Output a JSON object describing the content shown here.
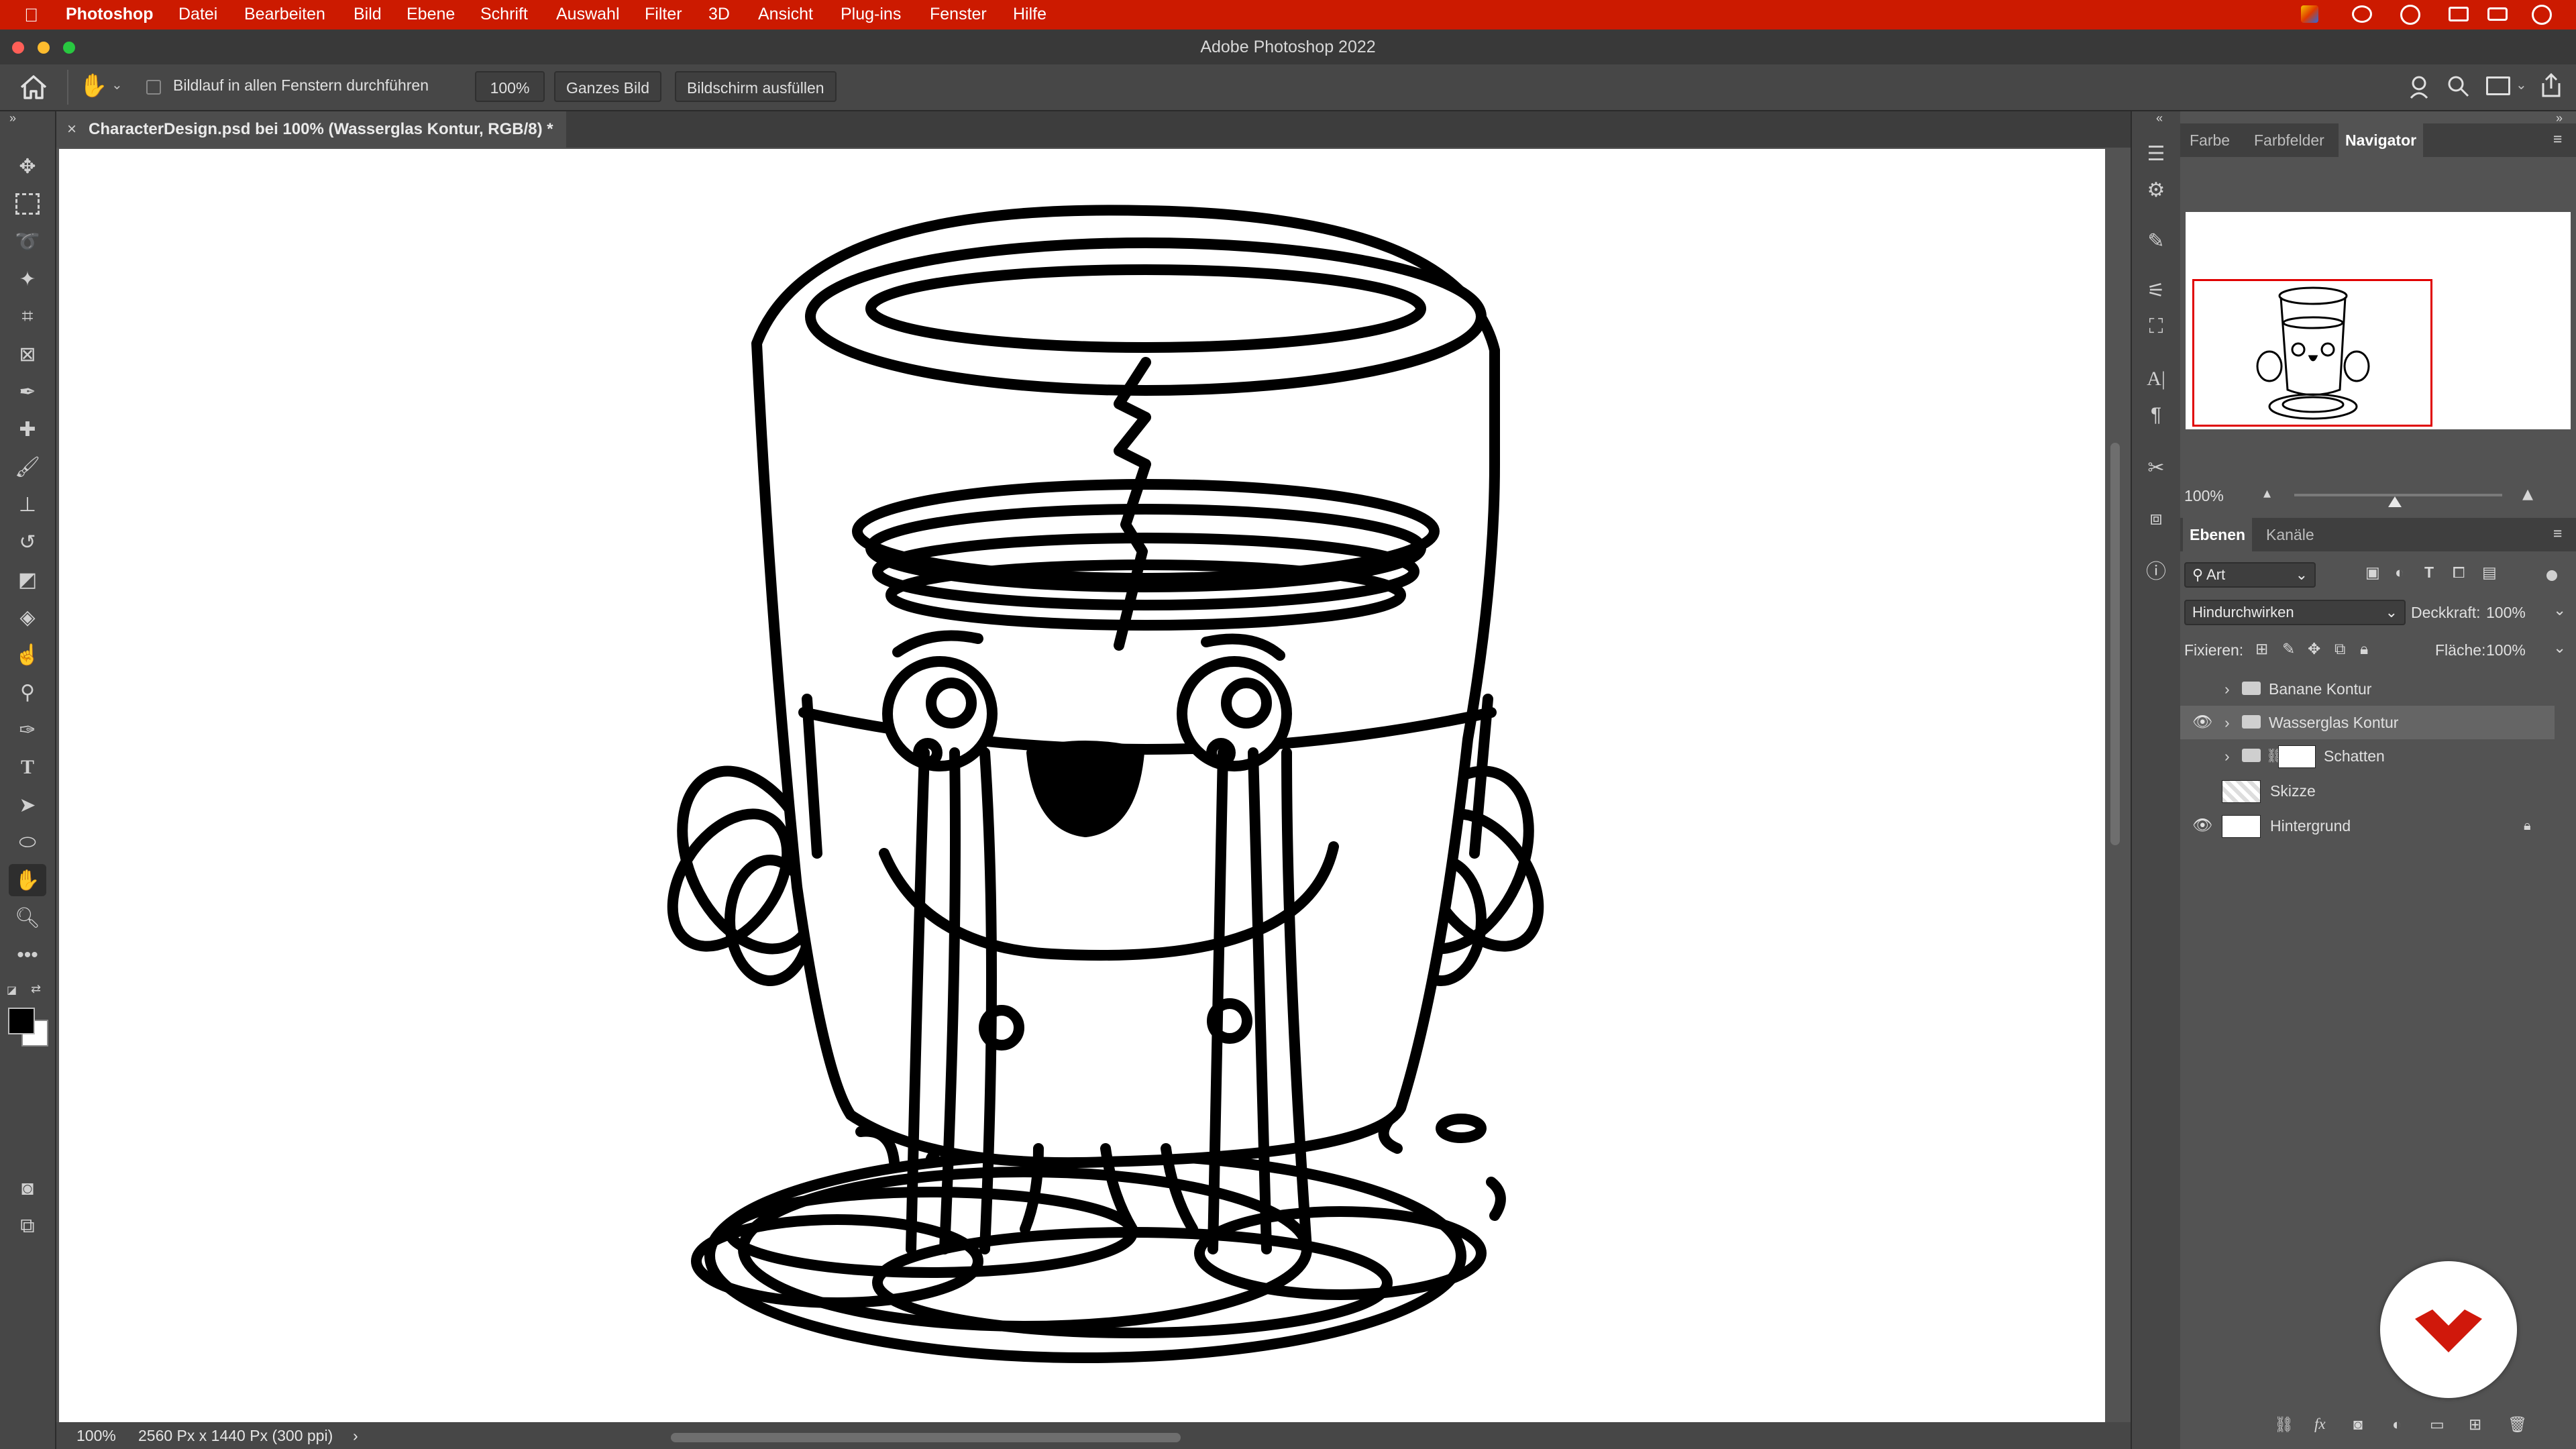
{
  "menu": {
    "apple": "",
    "items": [
      "Photoshop",
      "Datei",
      "Bearbeiten",
      "Bild",
      "Ebene",
      "Schrift",
      "Auswahl",
      "Filter",
      "3D",
      "Ansicht",
      "Plug-ins",
      "Fenster",
      "Hilfe"
    ]
  },
  "window": {
    "title": "Adobe Photoshop 2022"
  },
  "options": {
    "checkbox_label": "Bildlauf in allen Fenstern durchführen",
    "zoom_button": "100%",
    "fit_button": "Ganzes Bild",
    "fill_button": "Bildschirm ausfüllen"
  },
  "document": {
    "tab_close": "×",
    "tab_title": "CharacterDesign.psd bei 100% (Wasserglas Kontur, RGB/8) *"
  },
  "statusbar": {
    "zoom": "100%",
    "info": "2560 Px x 1440 Px (300 ppi)",
    "arrow": "›"
  },
  "navigator_panel": {
    "tabs": [
      "Farbe",
      "Farbfelder",
      "Navigator"
    ],
    "active_tab": "Navigator",
    "zoom": "100%"
  },
  "layers_panel": {
    "tabs": [
      "Ebenen",
      "Kanäle"
    ],
    "filter_value": "Art",
    "blend_mode": "Hindurchwirken",
    "opacity_label": "Deckkraft:",
    "opacity_value": "100%",
    "lock_label": "Fixieren:",
    "fill_label": "Fläche:",
    "fill_value": "100%",
    "layers": [
      {
        "name": "Banane Kontur",
        "visible": false,
        "type": "group"
      },
      {
        "name": "Wasserglas Kontur",
        "visible": true,
        "type": "group",
        "selected": true
      },
      {
        "name": "Schatten",
        "visible": false,
        "type": "group-mask"
      },
      {
        "name": "Skizze",
        "visible": false,
        "type": "pixel"
      },
      {
        "name": "Hintergrund",
        "visible": true,
        "type": "background",
        "locked": true
      }
    ]
  },
  "colors": {
    "menubar": "#cc1a00",
    "accent_red": "#cc1a00",
    "panel_bg": "#535353",
    "selected_row": "#656565"
  }
}
